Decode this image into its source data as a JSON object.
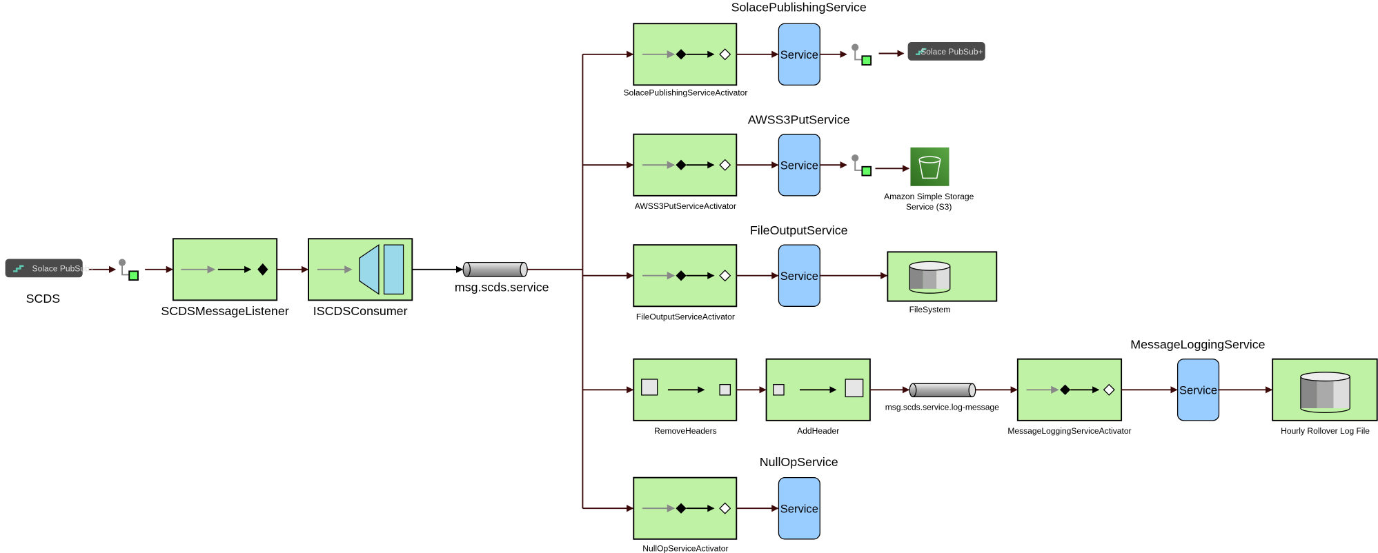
{
  "source": {
    "badge": "Solace PubSub+",
    "label": "SCDS"
  },
  "listener": {
    "label": "SCDSMessageListener"
  },
  "consumer": {
    "label": "ISCDSConsumer"
  },
  "channel": {
    "label": "msg.scds.service"
  },
  "service_label": "Service",
  "rows": {
    "solace": {
      "title": "SolacePublishingService",
      "activator": "SolacePublishingServiceActivator",
      "target_badge": "Solace PubSub+"
    },
    "s3": {
      "title": "AWSS3PutService",
      "activator": "AWSS3PutServiceActivator",
      "target_line1": "Amazon Simple Storage",
      "target_line2": "Service (S3)"
    },
    "file": {
      "title": "FileOutputService",
      "activator": "FileOutputServiceActivator",
      "target": "FileSystem"
    },
    "logging": {
      "remove_headers": "RemoveHeaders",
      "add_header": "AddHeader",
      "channel": "msg.scds.service.log-message",
      "activator": "MessageLoggingServiceActivator",
      "title": "MessageLoggingService",
      "target": "Hourly Rollover Log File"
    },
    "nullop": {
      "title": "NullOpService",
      "activator": "NullOpServiceActivator"
    }
  },
  "colors": {
    "component_fill": "#c0f2a6",
    "service_fill": "#99ccff",
    "connector": "#3d0a0a",
    "s3_green": "#3f8a2e",
    "badge_bg": "#4a4a4a"
  }
}
